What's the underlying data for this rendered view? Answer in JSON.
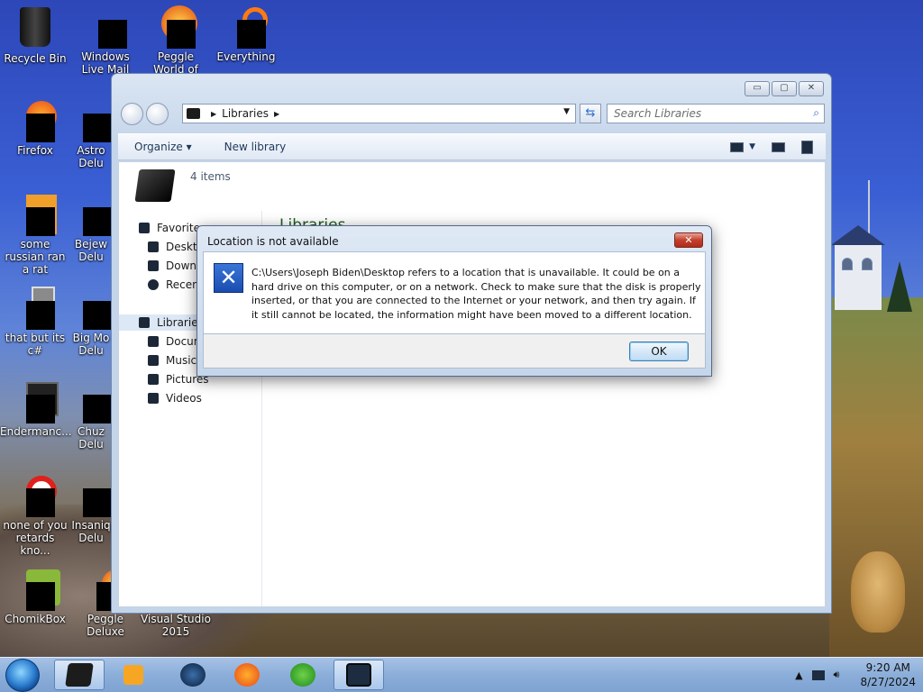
{
  "desktop": {
    "icons": [
      {
        "label": "Recycle Bin"
      },
      {
        "label": "Windows Live Mail"
      },
      {
        "label": "Peggle World of Warcraft"
      },
      {
        "label": "Everything"
      },
      {
        "label": "Firefox"
      },
      {
        "label": "Astro Delu"
      },
      {
        "label": "some russian ran a rat"
      },
      {
        "label": "Bejew Delu"
      },
      {
        "label": "that but its c#"
      },
      {
        "label": "Big Mo Delu"
      },
      {
        "label": "Endermanc..."
      },
      {
        "label": "Chuz Delu"
      },
      {
        "label": "none of you retards kno..."
      },
      {
        "label": "Insaniq Delu"
      },
      {
        "label": "ChomikBox"
      },
      {
        "label": "Peggle Deluxe"
      },
      {
        "label": "Visual Studio 2015"
      }
    ]
  },
  "explorer": {
    "window_controls": {
      "minimize": "▭",
      "maximize": "▢",
      "close": "✕"
    },
    "address_path": "Libraries",
    "search_placeholder": "Search Libraries",
    "toolbar": {
      "organize": "Organize ▾",
      "new_library": "New library"
    },
    "item_count": "4 items",
    "libraries_title": "Libraries",
    "nav": {
      "favorites": "Favorites",
      "fav_items": [
        "Deskto",
        "Downlo",
        "Recent"
      ],
      "libraries": "Libraries",
      "lib_items": [
        "Docum",
        "Music",
        "Pictures",
        "Videos"
      ]
    }
  },
  "dialog": {
    "title": "Location is not available",
    "close": "✕",
    "message": "C:\\Users\\Joseph Biden\\Desktop refers to a location that is unavailable. It could be on a hard drive on this computer, or on a network. Check to make sure that the disk is properly inserted, or that you are connected to the Internet or your network, and then try again. If it still cannot be located, the information might have been moved to a different location.",
    "ok": "OK"
  },
  "taskbar": {
    "time": "9:20 AM",
    "date": "8/27/2024"
  }
}
